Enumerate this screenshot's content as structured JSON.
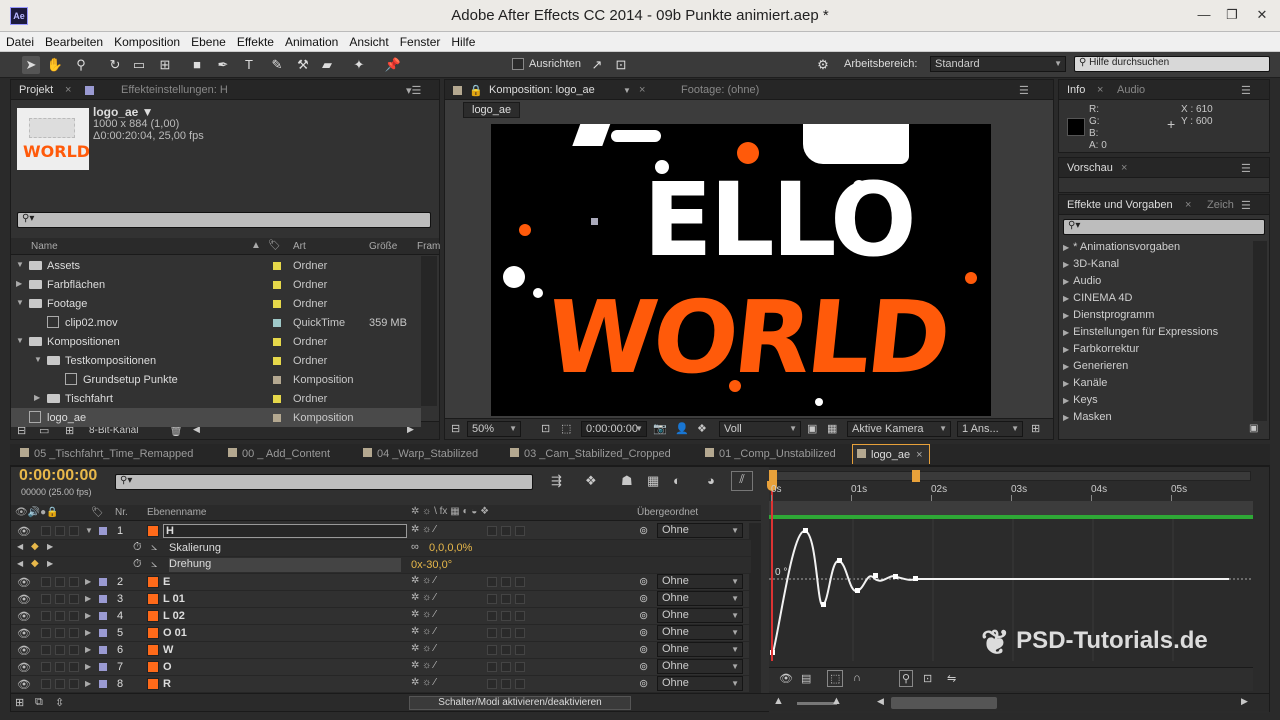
{
  "window": {
    "title": "Adobe After Effects CC 2014 - 09b Punkte animiert.aep *",
    "app_badge": "Ae"
  },
  "menu": [
    "Datei",
    "Bearbeiten",
    "Komposition",
    "Ebene",
    "Effekte",
    "Animation",
    "Ansicht",
    "Fenster",
    "Hilfe"
  ],
  "toolbar": {
    "align_label": "Ausrichten",
    "workspace_label": "Arbeitsbereich:",
    "workspace_value": "Standard",
    "help_placeholder": "Hilfe durchsuchen"
  },
  "project": {
    "tab": "Projekt",
    "tab2": "Effekteinstellungen: H",
    "item_name": "logo_ae ▼",
    "item_size": "1000 x 884 (1,00)",
    "item_duration": "Δ0:00:20:04, 25,00 fps",
    "thumb_text": "WORLD",
    "columns": {
      "name": "Name",
      "type": "Art",
      "size": "Größe",
      "frame": "Fram"
    },
    "rows": [
      {
        "name": "Assets",
        "type": "Ordner",
        "size": "",
        "color": "#e6d84a"
      },
      {
        "name": "Farbflächen",
        "type": "Ordner",
        "size": "",
        "color": "#e6d84a"
      },
      {
        "name": "Footage",
        "type": "Ordner",
        "size": "",
        "color": "#e6d84a"
      },
      {
        "name": "clip02.mov",
        "type": "QuickTime",
        "size": "359 MB",
        "color": "#9fc9c9"
      },
      {
        "name": "Kompositionen",
        "type": "Ordner",
        "size": "",
        "color": "#e6d84a"
      },
      {
        "name": "Testkompositionen",
        "type": "Ordner",
        "size": "",
        "color": "#e6d84a"
      },
      {
        "name": "Grundsetup Punkte",
        "type": "Komposition",
        "size": "",
        "color": "#b4a890"
      },
      {
        "name": "Tischfahrt",
        "type": "Ordner",
        "size": "",
        "color": "#e6d84a"
      },
      {
        "name": "logo_ae",
        "type": "Komposition",
        "size": "",
        "color": "#b4a890"
      }
    ],
    "bit_depth": "8-Bit-Kanal"
  },
  "comp": {
    "tab": "Komposition: logo_ae",
    "footage_tab": "Footage: (ohne)",
    "comp_name": "logo_ae",
    "line1": "ELLO",
    "line2": "WORLD",
    "zoom": "50%",
    "timecode": "0:00:00:00",
    "quality": "Voll",
    "camera": "Aktive Kamera",
    "views": "1 Ans..."
  },
  "info": {
    "tab": "Info",
    "audio_tab": "Audio",
    "r": "R:",
    "g": "G:",
    "b": "B:",
    "a": "A:  0",
    "x": "X : 610",
    "y": "Y : 600"
  },
  "preview": {
    "tab": "Vorschau"
  },
  "effects": {
    "tab": "Effekte und Vorgaben",
    "tab2": "Zeich",
    "items": [
      "* Animationsvorgaben",
      "3D-Kanal",
      "Audio",
      "CINEMA 4D",
      "Dienstprogramm",
      "Einstellungen für Expressions",
      "Farbkorrektur",
      "Generieren",
      "Kanäle",
      "Keys",
      "Masken"
    ]
  },
  "timeline": {
    "tabs": [
      "05 _Tischfahrt_Time_Remapped",
      "00 _ Add_Content",
      "04 _Warp_Stabilized",
      "03 _Cam_Stabilized_Cropped",
      "01 _Comp_Unstabilized",
      "logo_ae"
    ],
    "timecode": "0:00:00:00",
    "fps": "00000 (25.00 fps)",
    "col_nr": "Nr.",
    "col_name": "Ebenenname",
    "col_parent": "Übergeordnet",
    "ruler": [
      "0s",
      "01s",
      "02s",
      "03s",
      "04s",
      "05s"
    ],
    "graph_label": "0 °",
    "layers": [
      {
        "nr": "1",
        "name": "H",
        "parent": "Ohne"
      },
      {
        "nr": "2",
        "name": "E",
        "parent": "Ohne"
      },
      {
        "nr": "3",
        "name": "L 01",
        "parent": "Ohne"
      },
      {
        "nr": "4",
        "name": "L 02",
        "parent": "Ohne"
      },
      {
        "nr": "5",
        "name": "O 01",
        "parent": "Ohne"
      },
      {
        "nr": "6",
        "name": "W",
        "parent": "Ohne"
      },
      {
        "nr": "7",
        "name": "O",
        "parent": "Ohne"
      },
      {
        "nr": "8",
        "name": "R",
        "parent": "Ohne"
      }
    ],
    "props": [
      {
        "name": "Skalierung",
        "value": "0,0,0,0%"
      },
      {
        "name": "Drehung",
        "value": "0x-30,0°"
      }
    ],
    "footer": "Schalter/Modi aktivieren/deaktivieren"
  },
  "watermark": "PSD-Tutorials.de",
  "colors": {
    "accent": "#e8a13a",
    "orange": "#ff5a0a",
    "timecode": "#e8b84a"
  }
}
